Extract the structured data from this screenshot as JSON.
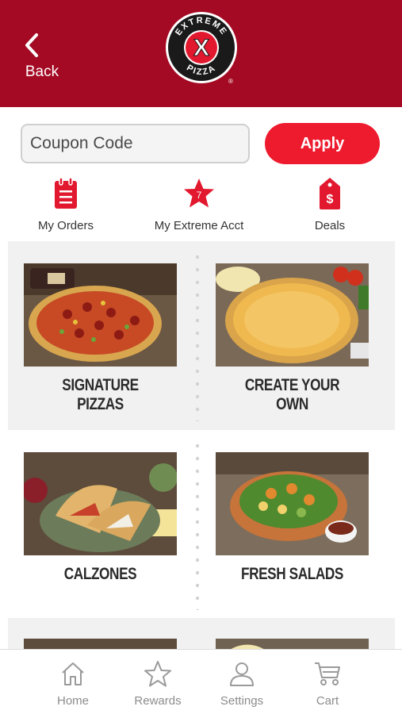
{
  "header": {
    "back_label": "Back",
    "logo_top": "EXTREME",
    "logo_bottom": "PIZZA",
    "logo_mark": "X",
    "logo_reg": "®"
  },
  "coupon": {
    "placeholder": "Coupon Code",
    "value": "",
    "apply_label": "Apply"
  },
  "quick_nav": [
    {
      "label": "My Orders",
      "icon": "clipboard-icon"
    },
    {
      "label": "My Extreme Acct",
      "icon": "star-icon",
      "badge": "7"
    },
    {
      "label": "Deals",
      "icon": "price-tag-icon",
      "symbol": "$"
    }
  ],
  "menu": [
    {
      "label": "SIGNATURE PIZZAS"
    },
    {
      "label": "CREATE YOUR OWN"
    },
    {
      "label": "CALZONES"
    },
    {
      "label": "FRESH SALADS"
    }
  ],
  "tabs": [
    {
      "label": "Home",
      "icon": "home-icon"
    },
    {
      "label": "Rewards",
      "icon": "star-outline-icon"
    },
    {
      "label": "Settings",
      "icon": "person-icon"
    },
    {
      "label": "Cart",
      "icon": "cart-icon"
    }
  ],
  "colors": {
    "header_bg": "#a40a23",
    "accent": "#ee1a2d",
    "tab_icon": "#9a9a9a"
  }
}
